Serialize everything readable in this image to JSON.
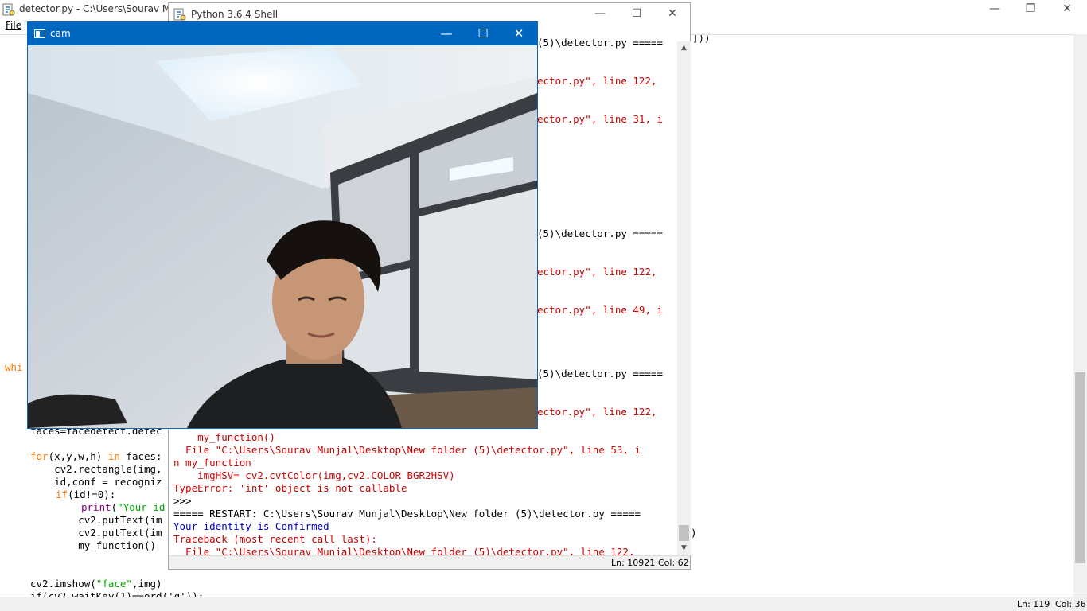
{
  "editor": {
    "title": "detector.py - C:\\Users\\Sourav Munj",
    "menu_file": "File",
    "tail_top": "]))",
    "code": {
      "whi": "whi",
      "faces": "faces=facedetect.detec",
      "for_kw": "for",
      "for_rest": "(x,y,w,h) ",
      "in_kw": "in",
      "for_tail": " faces:",
      "rect": "    cv2.rectangle(img,",
      "idconf": "    id,conf = recogniz",
      "if_kw": "if",
      "if_rest": "(id!=0):",
      "print_bi": "print",
      "print_open": "(",
      "print_str": "\"Your id",
      "puttext1": "        cv2.putText(im",
      "puttext2": "        cv2.putText(im",
      "myfunc": "        my_function()",
      "imshow_pre": "cv2.imshow(",
      "imshow_str": "\"face\"",
      "imshow_post": ",img)",
      "waitkey": "if(cv2.waitKey(1)==ord('q')):",
      "tail_right": ")"
    },
    "status_ln": "Ln: 119",
    "status_col": "Col: 36"
  },
  "shell": {
    "title": "Python 3.6.4 Shell",
    "lines_right": [
      "(5)\\detector.py =====",
      "ector.py\", line 122,",
      "ector.py\", line 31, i",
      "(5)\\detector.py =====",
      "ector.py\", line 122,",
      "ector.py\", line 49, i",
      "(5)\\detector.py =====",
      "ector.py\", line 122,"
    ],
    "lines_full": [
      "    my_function()",
      "  File \"C:\\Users\\Sourav Munjal\\Desktop\\New folder (5)\\detector.py\", line 53, i",
      "n my_function",
      "    imgHSV= cv2.cvtColor(img,cv2.COLOR_BGR2HSV)",
      "TypeError: 'int' object is not callable",
      ">>>",
      "===== RESTART: C:\\Users\\Sourav Munjal\\Desktop\\New folder (5)\\detector.py =====",
      "Your identity is Confirmed",
      "Traceback (most recent call last):",
      "  File \"C:\\Users\\Sourav Munjal\\Desktop\\New folder (5)\\detector.py\", line 122,"
    ],
    "status_ln": "Ln: 10921",
    "status_col": "Col: 62"
  },
  "cam": {
    "title": "cam"
  },
  "icons": {
    "minimize": "minimize-icon",
    "maximize": "maximize-icon",
    "restore": "restore-icon",
    "close": "close-icon"
  },
  "colors": {
    "cam_titlebar": "#0067c0",
    "traceback_red": "#cc0000",
    "confirmed_blue": "#0000cc",
    "keyword_orange": "#ff7700"
  }
}
